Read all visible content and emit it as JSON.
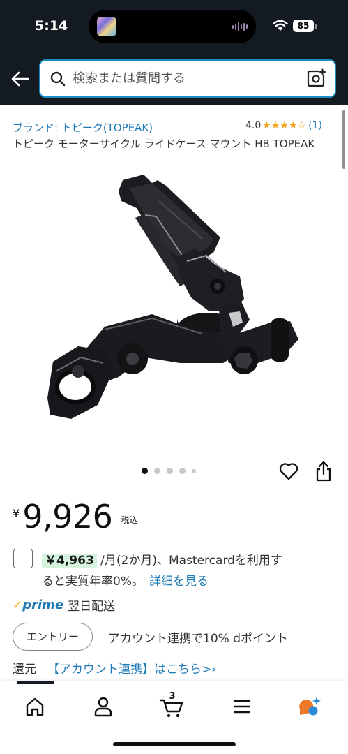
{
  "status_bar": {
    "time": "5:14",
    "battery": "85"
  },
  "header": {
    "search_placeholder": "検索または質問する"
  },
  "product": {
    "brand": "ブランド: トピーク(TOPEAK)",
    "rating_value": "4.0",
    "rating_stars": 4,
    "rating_count": "(1)",
    "title": "トピーク モーターサイクル ライドケース マウント HB TOPEAK",
    "image_count": 5,
    "active_image": 1
  },
  "price": {
    "currency": "¥",
    "value": "9,926",
    "tax_label": "税込"
  },
  "installment": {
    "amount": "￥4,963",
    "line1_rest": " /月(2か月)、Mastercardを利用す",
    "line2": "ると実質年率0%。",
    "detail_link": "詳細を見る"
  },
  "prime": {
    "check": "✓",
    "logo": "prime",
    "delivery": "翌日配送"
  },
  "entry": {
    "button": "エントリー",
    "text": "アカウント連携で10% dポイント",
    "line2": "還元",
    "link": "【アカウント連携】はこちら>›"
  },
  "bottom_nav": {
    "cart_count": "3",
    "items": [
      "home-icon",
      "account-icon",
      "cart-icon",
      "menu-icon",
      "rufus-icon"
    ]
  },
  "colors": {
    "header_bg": "#131a22",
    "link": "#1f7bb6",
    "star": "#f2a51d",
    "installment_highlight": "#d6f3dd",
    "search_border": "#1b8cc0"
  }
}
